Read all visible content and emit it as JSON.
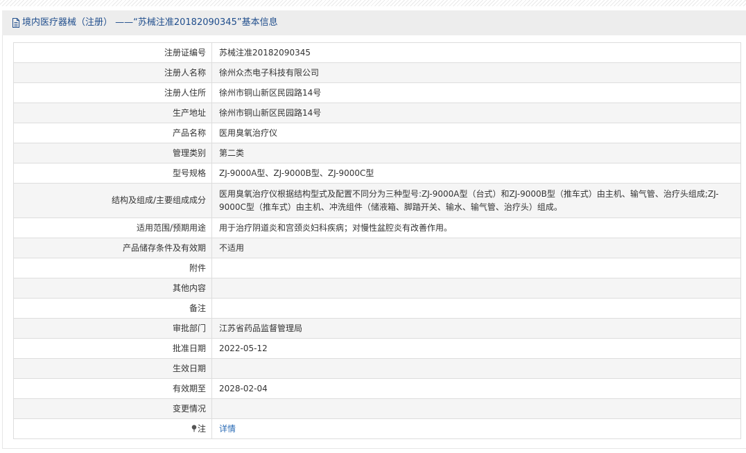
{
  "header": {
    "title": "境内医疗器械（注册） ——“苏械注准20182090345”基本信息",
    "icon": "document-icon"
  },
  "rows": [
    {
      "label": "注册证编号",
      "value": "苏械注准20182090345"
    },
    {
      "label": "注册人名称",
      "value": "徐州众杰电子科技有限公司"
    },
    {
      "label": "注册人住所",
      "value": "徐州市铜山新区民园路14号"
    },
    {
      "label": "生产地址",
      "value": "徐州市铜山新区民园路14号"
    },
    {
      "label": "产品名称",
      "value": "医用臭氧治疗仪"
    },
    {
      "label": "管理类别",
      "value": "第二类"
    },
    {
      "label": "型号规格",
      "value": "ZJ-9000A型、ZJ-9000B型、ZJ-9000C型"
    },
    {
      "label": "结构及组成/主要组成成分",
      "value": "医用臭氧治疗仪根据结构型式及配置不同分为三种型号:ZJ-9000A型（台式）和ZJ-9000B型（推车式）由主机、输气管、治疗头组成;ZJ-9000C型（推车式）由主机、冲洗组件（储液箱、脚踏开关、输水、输气管、治疗头）组成。"
    },
    {
      "label": "适用范围/预期用途",
      "value": "用于治疗阴道炎和宫颈炎妇科疾病；对慢性盆腔炎有改善作用。"
    },
    {
      "label": "产品储存条件及有效期",
      "value": "不适用"
    },
    {
      "label": "附件",
      "value": ""
    },
    {
      "label": "其他内容",
      "value": ""
    },
    {
      "label": "备注",
      "value": ""
    },
    {
      "label": "审批部门",
      "value": "江苏省药品监督管理局"
    },
    {
      "label": "批准日期",
      "value": "2022-05-12"
    },
    {
      "label": "生效日期",
      "value": ""
    },
    {
      "label": "有效期至",
      "value": "2028-02-04"
    },
    {
      "label": "变更情况",
      "value": ""
    }
  ],
  "note": {
    "label": "注",
    "icon": "pin-icon",
    "link_text": "详情"
  },
  "colors": {
    "title_text": "#1f4d8c",
    "link": "#2a6bb5",
    "row_alt": "#f5f5f5",
    "border": "#dddddd"
  }
}
